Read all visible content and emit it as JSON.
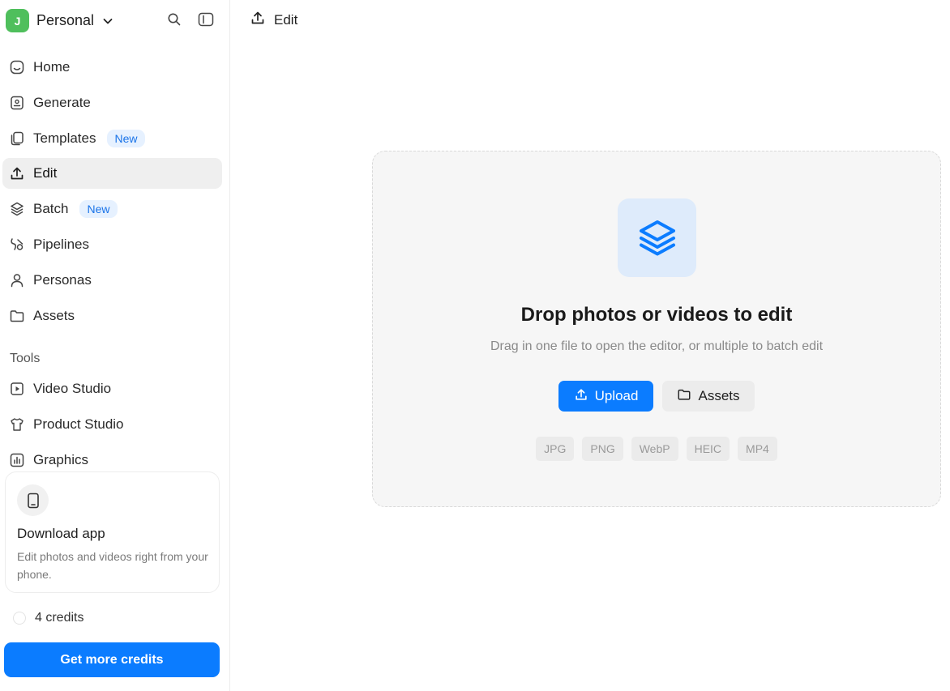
{
  "workspace": {
    "avatar_letter": "J",
    "name": "Personal"
  },
  "nav": {
    "home": "Home",
    "generate": "Generate",
    "templates": "Templates",
    "templates_badge": "New",
    "edit": "Edit",
    "batch": "Batch",
    "batch_badge": "New",
    "pipelines": "Pipelines",
    "personas": "Personas",
    "assets": "Assets"
  },
  "tools": {
    "heading": "Tools",
    "video_studio": "Video Studio",
    "product_studio": "Product Studio",
    "graphics": "Graphics"
  },
  "download": {
    "title": "Download app",
    "text": "Edit photos and videos right from your phone."
  },
  "credits": {
    "label": "4 credits",
    "cta": "Get more credits"
  },
  "header": {
    "title": "Edit"
  },
  "dropzone": {
    "title": "Drop photos or videos to edit",
    "subtitle": "Drag in one file to open the editor, or multiple to batch edit",
    "upload_label": "Upload",
    "assets_label": "Assets",
    "formats": [
      "JPG",
      "PNG",
      "WebP",
      "HEIC",
      "MP4"
    ]
  },
  "colors": {
    "accent": "#0b7cff",
    "avatar": "#4fbf5c",
    "badge_bg": "#e6f1ff",
    "badge_text": "#1a73e8",
    "icon_tile": "#deebfb"
  }
}
